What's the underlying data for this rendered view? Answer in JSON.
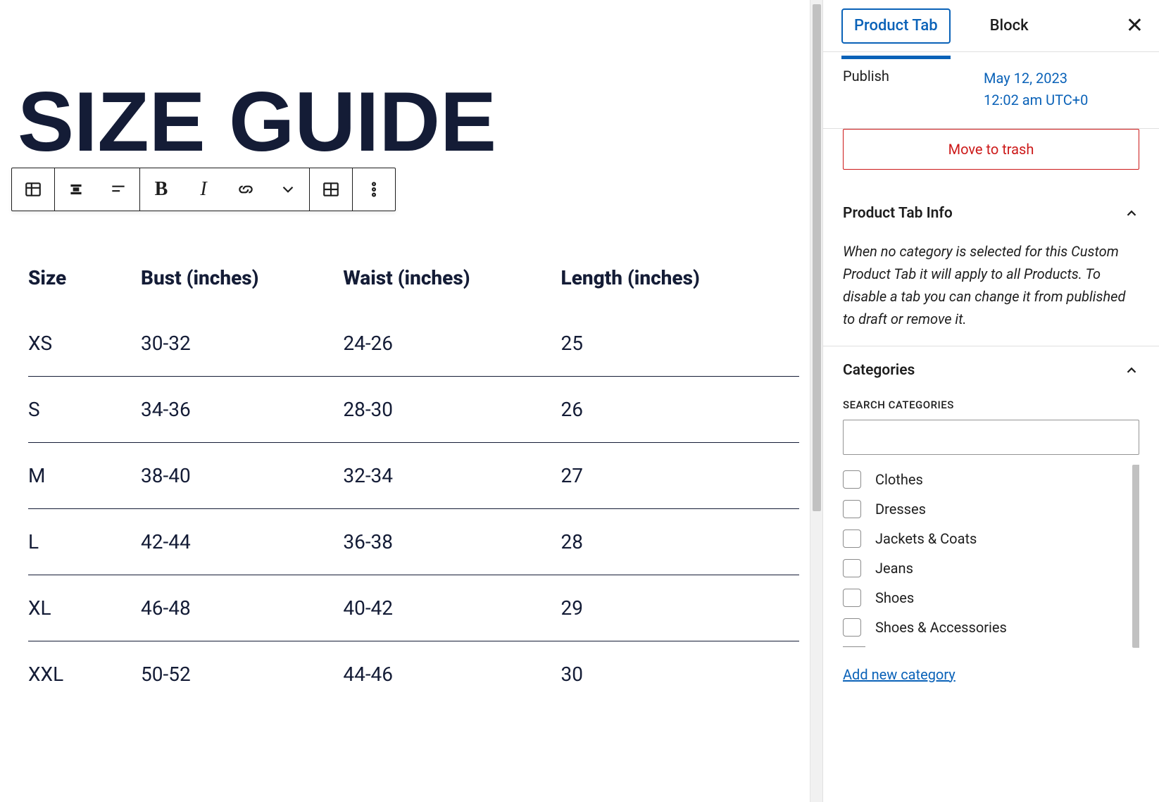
{
  "doc": {
    "title": "SIZE GUIDE"
  },
  "table": {
    "headers": [
      "Size",
      "Bust (inches)",
      "Waist (inches)",
      "Length (inches)"
    ],
    "rows": [
      [
        "XS",
        "30-32",
        "24-26",
        "25"
      ],
      [
        "S",
        "34-36",
        "28-30",
        "26"
      ],
      [
        "M",
        "38-40",
        "32-34",
        "27"
      ],
      [
        "L",
        "42-44",
        "36-38",
        "28"
      ],
      [
        "XL",
        "46-48",
        "40-42",
        "29"
      ],
      [
        "XXL",
        "50-52",
        "44-46",
        "30"
      ]
    ]
  },
  "sidebar": {
    "tabs": {
      "product": "Product Tab",
      "block": "Block"
    },
    "publish": {
      "label": "Publish",
      "date_line1": "May 12, 2023",
      "date_line2": "12:02 am UTC+0"
    },
    "trash_label": "Move to trash",
    "info": {
      "heading": "Product Tab Info",
      "text": "When no category is selected for this Custom Product Tab it will apply to all Products. To disable a tab you can change it from published to draft or remove it."
    },
    "categories": {
      "heading": "Categories",
      "search_label": "SEARCH CATEGORIES",
      "items": [
        "Clothes",
        "Dresses",
        "Jackets & Coats",
        "Jeans",
        "Shoes",
        "Shoes & Accessories"
      ],
      "add_link": "Add new category"
    }
  }
}
